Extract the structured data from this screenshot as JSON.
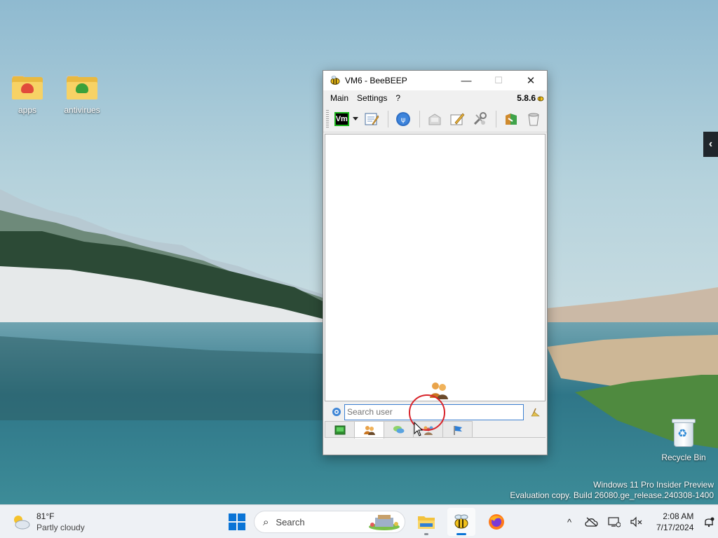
{
  "desktop": {
    "icons": [
      {
        "label": "apps",
        "icon": "folder-icon"
      },
      {
        "label": "antivirues",
        "icon": "folder-icon"
      }
    ],
    "recycle_bin": {
      "label": "Recycle Bin",
      "icon": "recycle-bin-icon"
    },
    "watermark": {
      "line1": "Windows 11 Pro Insider Preview",
      "line2": "Evaluation copy. Build 26080.ge_release.240308-1400"
    },
    "side_handle": "‹"
  },
  "window": {
    "title": "VM6 - BeeBEEP",
    "controls": {
      "minimize": "—",
      "maximize": "☐",
      "close": "✕"
    },
    "menu": [
      "Main",
      "Settings",
      "?"
    ],
    "version": "5.8.6",
    "toolbar": {
      "profile_label": "Vm",
      "items": [
        "edit-profile-icon",
        "network-icon",
        "send-file-icon",
        "write-message-icon",
        "tools-icon",
        "plugins-icon",
        "clear-icon"
      ]
    },
    "search": {
      "placeholder": "Search user"
    },
    "tabs": [
      "home-tab",
      "users-tab",
      "chats-tab",
      "groups-tab",
      "shares-tab"
    ]
  },
  "taskbar": {
    "weather": {
      "temp": "81°F",
      "condition": "Partly cloudy"
    },
    "search_label": "Search",
    "apps": [
      "file-explorer-icon",
      "beebeep-icon",
      "firefox-icon"
    ],
    "tray": {
      "chevron": "^",
      "time": "2:08 AM",
      "date": "7/17/2024"
    }
  },
  "colors": {
    "accent": "#0a74d6",
    "click_ring": "#d8232a",
    "vm_border": "#18b218"
  }
}
